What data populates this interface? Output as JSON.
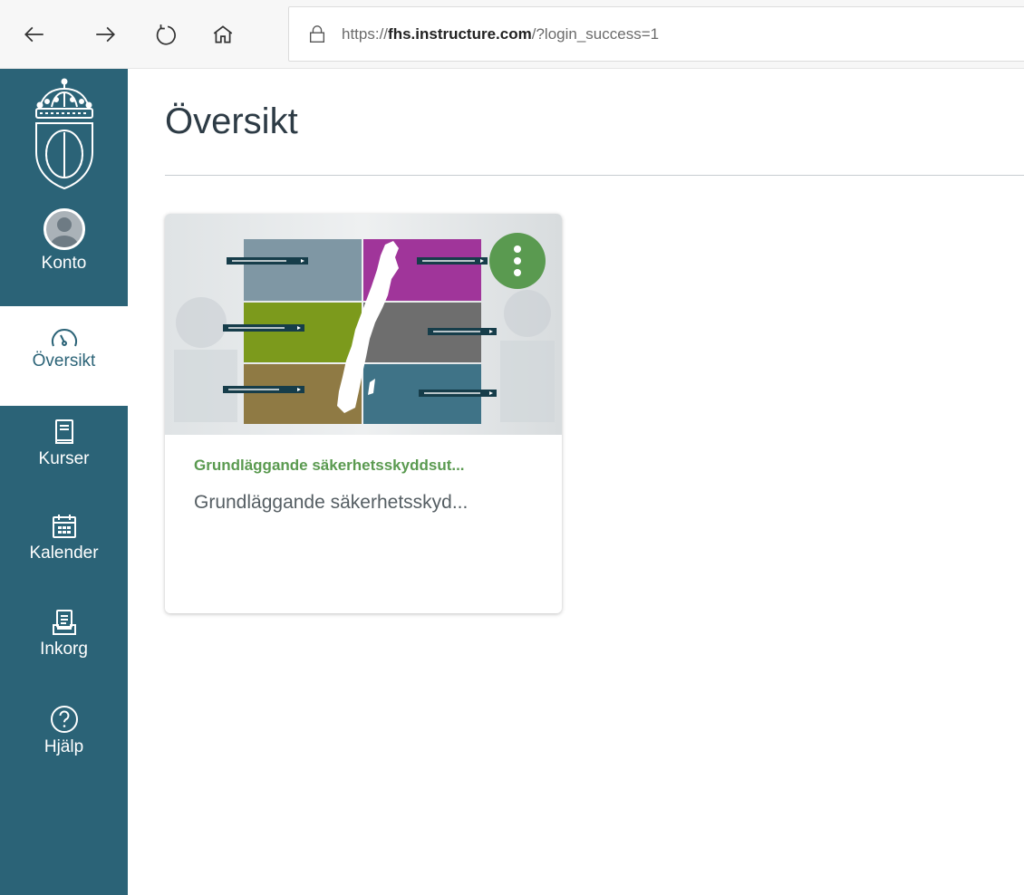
{
  "browser": {
    "url_scheme": "https://",
    "url_host": "fhs.instructure.com",
    "url_path": "/?login_success=1"
  },
  "sidebar": {
    "items": [
      {
        "label": "Konto",
        "icon": "avatar-icon"
      },
      {
        "label": "Översikt",
        "icon": "dashboard-icon"
      },
      {
        "label": "Kurser",
        "icon": "book-icon"
      },
      {
        "label": "Kalender",
        "icon": "calendar-icon"
      },
      {
        "label": "Inkorg",
        "icon": "inbox-icon"
      },
      {
        "label": "Hjälp",
        "icon": "help-icon"
      }
    ]
  },
  "main": {
    "title": "Översikt",
    "cards": [
      {
        "title": "Grundläggande säkerhetsskyddsut...",
        "subtitle": "Grundläggande säkerhetsskyd..."
      }
    ]
  },
  "colors": {
    "sidebar": "#2b6377",
    "card_accent": "#5a9a50",
    "title_text": "#2d3b45"
  }
}
